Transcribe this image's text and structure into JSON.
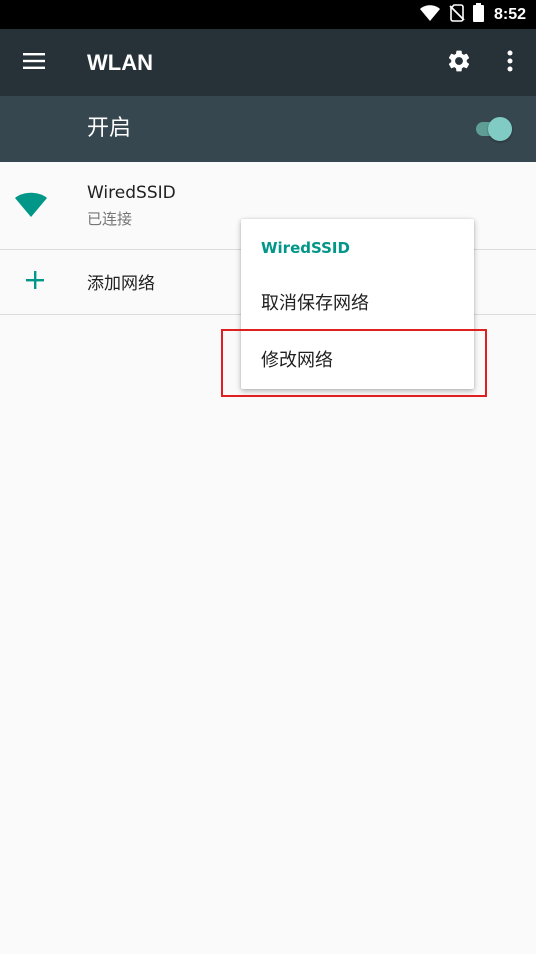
{
  "status_bar": {
    "time": "8:52",
    "icons": [
      "wifi-signal-icon",
      "no-sim-icon",
      "battery-icon"
    ]
  },
  "toolbar": {
    "title": "WLAN",
    "icons": [
      "menu-icon",
      "gear-icon",
      "overflow-icon"
    ]
  },
  "switch_bar": {
    "label": "开启",
    "enabled": true
  },
  "networks": [
    {
      "name": "WiredSSID",
      "status": "已连接",
      "icon": "wifi-full-icon"
    }
  ],
  "add_network": {
    "label": "添加网络",
    "icon": "plus-icon"
  },
  "popup_menu": {
    "title": "WiredSSID",
    "items": [
      {
        "label": "取消保存网络"
      },
      {
        "label": "修改网络"
      }
    ]
  },
  "colors": {
    "toolbar_bg": "#263238",
    "switch_bar_bg": "#37474f",
    "accent": "#009688",
    "highlight": "#e02020"
  }
}
